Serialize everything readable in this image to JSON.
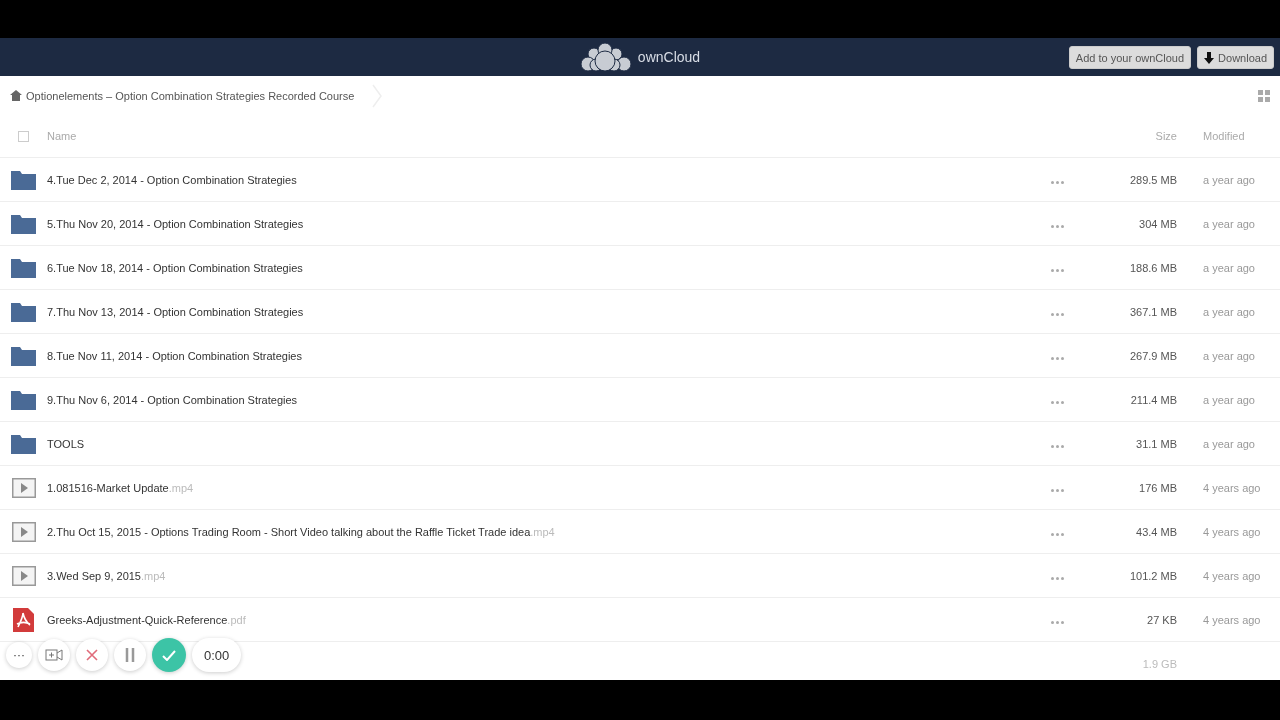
{
  "header": {
    "brand": "ownCloud",
    "buttons": [
      {
        "label": "Add to your ownCloud",
        "kind": "plain"
      },
      {
        "label": "Download",
        "kind": "download"
      }
    ]
  },
  "breadcrumb": {
    "title": "Optionelements – Option Combination Strategies Recorded Course"
  },
  "table": {
    "select_all": {
      "checked": false
    },
    "columns": {
      "name": "Name",
      "size": "Size",
      "modified": "Modified"
    },
    "rows": [
      {
        "kind": "folder",
        "name": "4.Tue Dec 2, 2014 - Option Combination Strategies",
        "size": "289.5 MB",
        "modified": "a year ago"
      },
      {
        "kind": "folder",
        "name": "5.Thu Nov 20, 2014 - Option Combination Strategies",
        "size": "304 MB",
        "modified": "a year ago"
      },
      {
        "kind": "folder",
        "name": "6.Tue Nov 18, 2014 - Option Combination Strategies",
        "size": "188.6 MB",
        "modified": "a year ago"
      },
      {
        "kind": "folder",
        "name": "7.Thu Nov 13, 2014 - Option Combination Strategies",
        "size": "367.1 MB",
        "modified": "a year ago"
      },
      {
        "kind": "folder",
        "name": "8.Tue Nov 11, 2014 - Option Combination Strategies",
        "size": "267.9 MB",
        "modified": "a year ago"
      },
      {
        "kind": "folder",
        "name": "9.Thu Nov 6, 2014 - Option Combination Strategies",
        "size": "211.4 MB",
        "modified": "a year ago"
      },
      {
        "kind": "folder",
        "name": "TOOLS",
        "size": "31.1 MB",
        "modified": "a year ago"
      },
      {
        "kind": "video",
        "name": "1.081516-Market Update",
        "ext": ".mp4",
        "size": "176 MB",
        "modified": "4 years ago"
      },
      {
        "kind": "video",
        "name": "2.Thu Oct 15, 2015 - Options Trading Room - Short Video talking about the Raffle Ticket Trade idea",
        "ext": ".mp4",
        "size": "43.4 MB",
        "modified": "4 years ago"
      },
      {
        "kind": "video",
        "name": "3.Wed Sep 9, 2015",
        "ext": ".mp4",
        "size": "101.2 MB",
        "modified": "4 years ago"
      },
      {
        "kind": "pdf",
        "name": "Greeks-Adjustment-Quick-Reference",
        "ext": ".pdf",
        "size": "27 KB",
        "modified": "4 years ago"
      }
    ],
    "summary": {
      "size": "1.9 GB"
    }
  },
  "recorder": {
    "more": "···",
    "timer": "0:00"
  }
}
